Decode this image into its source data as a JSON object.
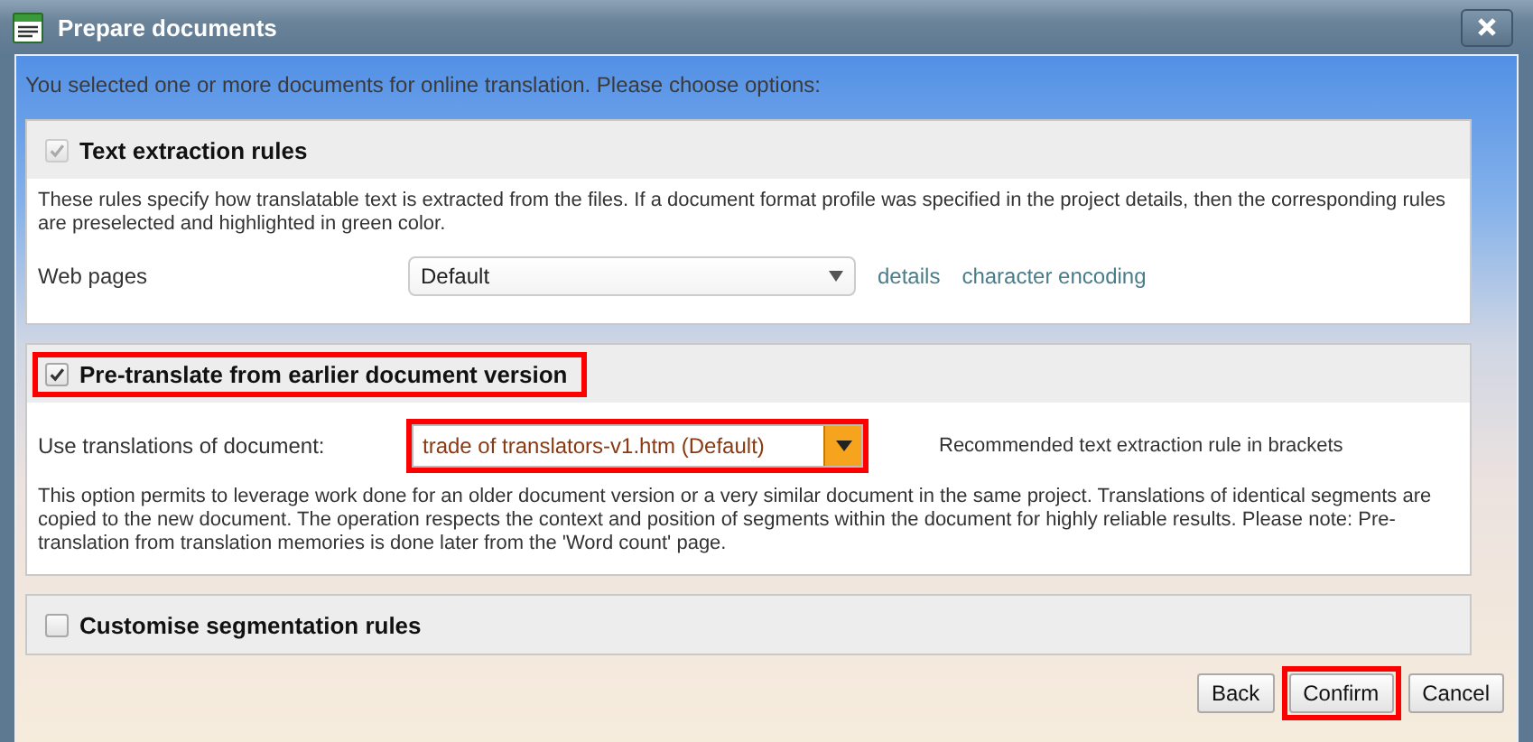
{
  "window": {
    "title": "Prepare documents"
  },
  "intro": "You selected one or more documents for online translation. Please choose options:",
  "sections": [
    {
      "title": "Text extraction rules",
      "checked": true,
      "disabled": true,
      "highlighted": false,
      "content": [
        {
          "kind": "text",
          "text": "These rules specify how translatable text is extracted from the files. If a document format profile was specified in the project details, then the corresponding rules are preselected and highlighted in green color."
        },
        {
          "kind": "select-row",
          "label": "Web pages",
          "value": "Default",
          "links": [
            "details",
            "character encoding"
          ]
        }
      ]
    },
    {
      "title": "Pre-translate from earlier document version",
      "checked": true,
      "disabled": false,
      "highlighted": true,
      "content": [
        {
          "kind": "field-row",
          "label": "Use translations of document:",
          "value": "trade of translators-v1.htm (Default)",
          "highlighted": true,
          "hint": "Recommended text extraction rule in brackets"
        },
        {
          "kind": "text",
          "text": "This option permits to leverage work done for an older document version or a very similar document in the same project. Translations of identical segments are copied to the new document. The operation respects the context and position of segments within the document for highly reliable results. Please note: Pre-translation from translation memories is done later from the 'Word count' page."
        }
      ]
    },
    {
      "title": "Customise segmentation rules",
      "checked": false,
      "disabled": false,
      "highlighted": false
    }
  ],
  "buttons": [
    {
      "label": "Back",
      "highlighted": false
    },
    {
      "label": "Confirm",
      "highlighted": true
    },
    {
      "label": "Cancel",
      "highlighted": false
    }
  ]
}
